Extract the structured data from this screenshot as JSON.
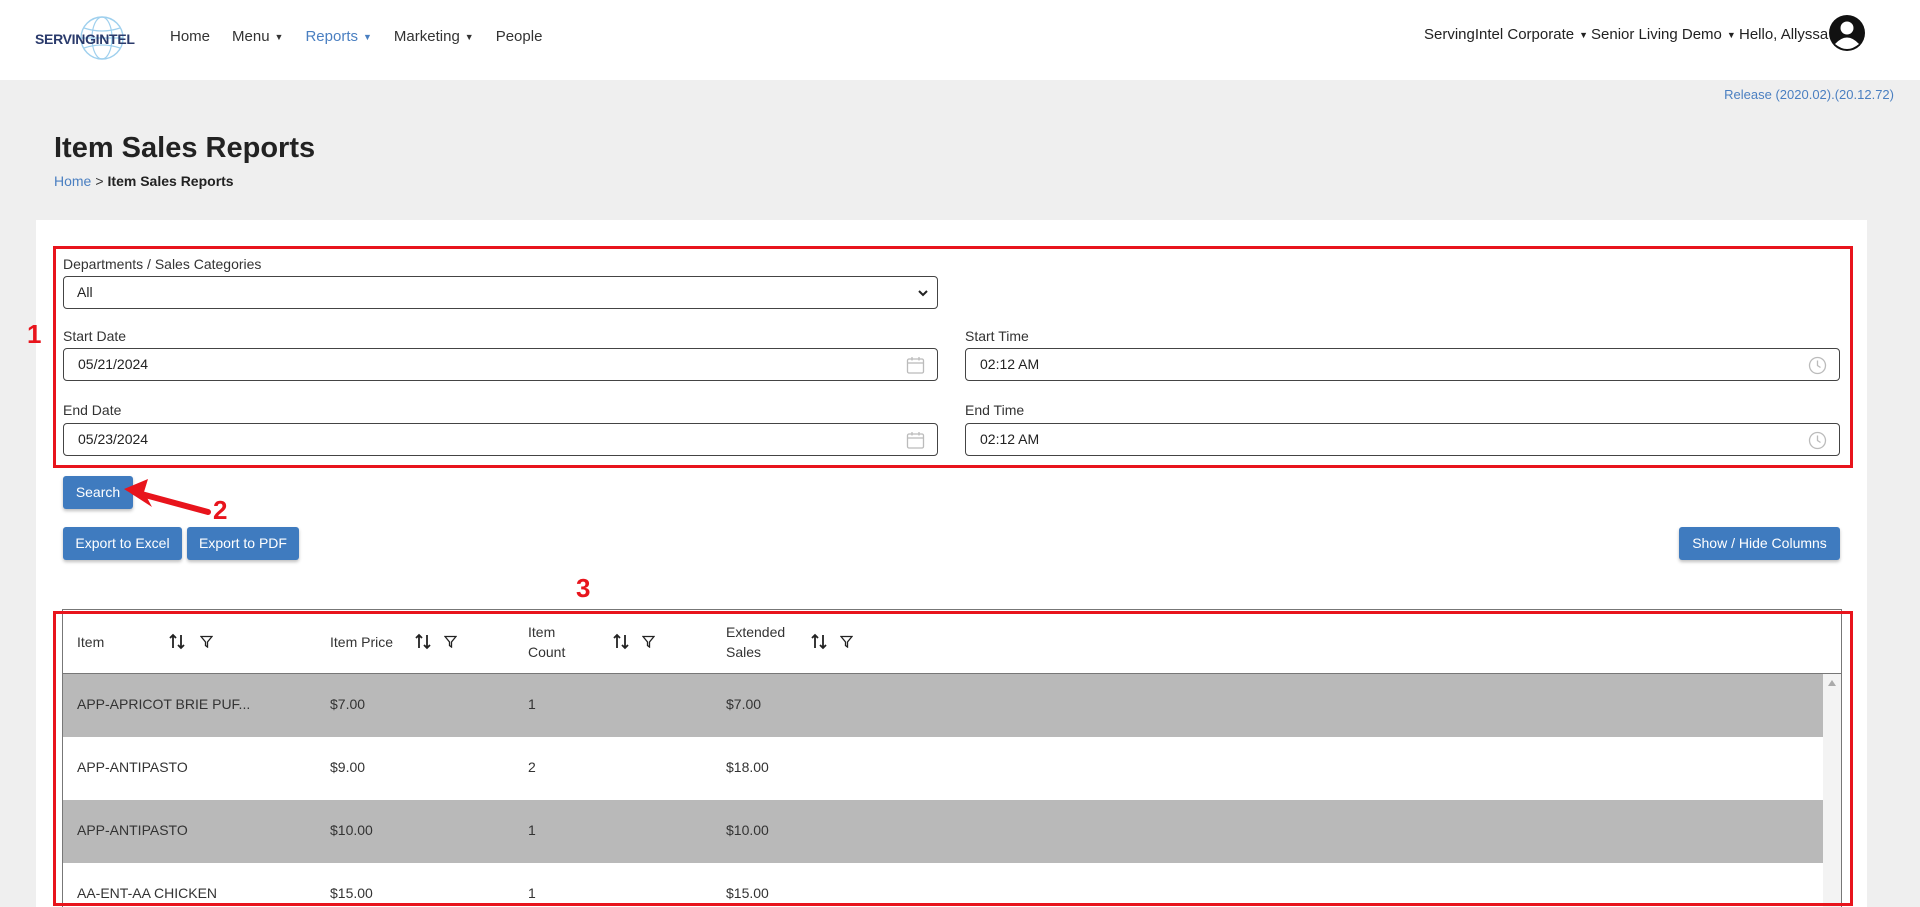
{
  "brand": {
    "logo_text": "SERVINGINTEL"
  },
  "nav": {
    "items": [
      {
        "label": "Home",
        "has_caret": false,
        "active": false
      },
      {
        "label": "Menu",
        "has_caret": true,
        "active": false
      },
      {
        "label": "Reports",
        "has_caret": true,
        "active": true
      },
      {
        "label": "Marketing",
        "has_caret": true,
        "active": false
      },
      {
        "label": "People",
        "has_caret": false,
        "active": false
      }
    ],
    "org": "ServingIntel Corporate",
    "site": "Senior Living Demo",
    "greeting": "Hello, Allyssa",
    "caret": "⌄"
  },
  "release": "Release (2020.02).(20.12.72)",
  "page": {
    "title": "Item Sales Reports",
    "breadcrumb": {
      "home": "Home",
      "separator": ">",
      "current": "Item Sales Reports"
    }
  },
  "filters": {
    "department_label": "Departments / Sales Categories",
    "department_value": "All",
    "start_date_label": "Start Date",
    "start_date_value": "05/21/2024",
    "start_time_label": "Start Time",
    "start_time_value": "02:12 AM",
    "end_date_label": "End Date",
    "end_date_value": "05/23/2024",
    "end_time_label": "End Time",
    "end_time_value": "02:12 AM"
  },
  "buttons": {
    "search": "Search",
    "export_excel": "Export to Excel",
    "export_pdf": "Export to PDF",
    "show_hide": "Show / Hide Columns"
  },
  "table": {
    "columns": [
      {
        "line1": "Item",
        "line2": ""
      },
      {
        "line1": "Item Price",
        "line2": ""
      },
      {
        "line1": "Item",
        "line2": "Count"
      },
      {
        "line1": "Extended",
        "line2": "Sales"
      }
    ],
    "rows": [
      {
        "item": "APP-APRICOT BRIE PUF...",
        "price": "$7.00",
        "count": "1",
        "extended": "$7.00"
      },
      {
        "item": "APP-ANTIPASTO",
        "price": "$9.00",
        "count": "2",
        "extended": "$18.00"
      },
      {
        "item": "APP-ANTIPASTO",
        "price": "$10.00",
        "count": "1",
        "extended": "$10.00"
      },
      {
        "item": "AA-ENT-AA CHICKEN",
        "price": "$15.00",
        "count": "1",
        "extended": "$15.00"
      }
    ]
  },
  "annotations": {
    "n1": "1",
    "n2": "2",
    "n3": "3"
  },
  "colors": {
    "accent": "#3f7bbf",
    "link": "#4a7fc1",
    "annotation": "#e8141c",
    "row_alt": "#b9b9b9"
  }
}
